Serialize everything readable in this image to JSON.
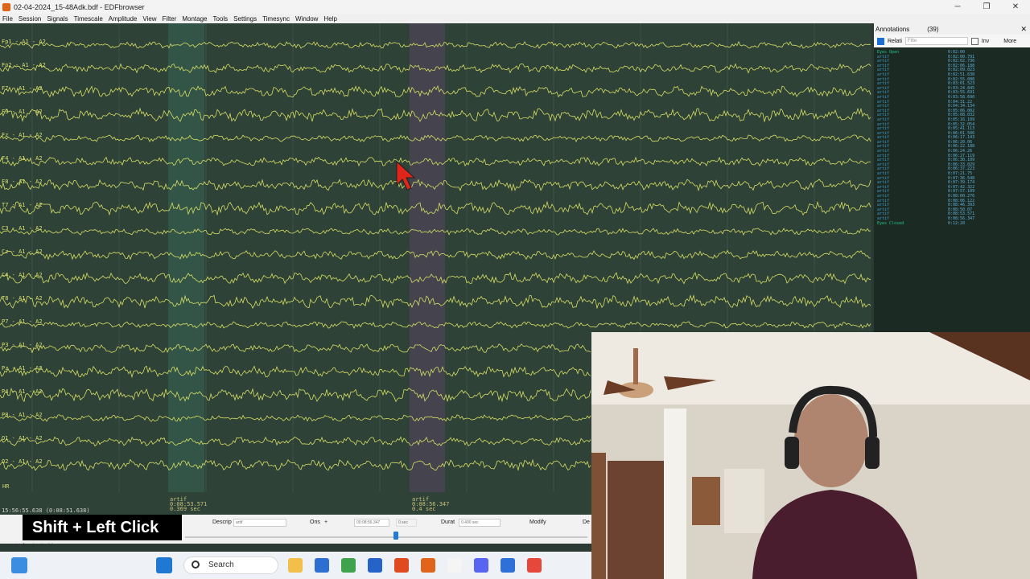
{
  "window": {
    "title": "02-04-2024_15-48Adk.bdf - EDFbrowser",
    "controls": [
      "─",
      "❐",
      "✕"
    ]
  },
  "menu": [
    "File",
    "Session",
    "Signals",
    "Timescale",
    "Amplitude",
    "View",
    "Filter",
    "Montage",
    "Tools",
    "Settings",
    "Timesync",
    "Window",
    "Help"
  ],
  "signals": {
    "channels": [
      "Fp1 - A1 - A2",
      "Fp2 - A1 - A2",
      "F7 - A1 - A2",
      "F3 - A1 - A2",
      "Fz - A1 - A2",
      "F4 - A1 - A2",
      "F8 - A1 - A2",
      "T7 - A1 - A2",
      "C3 - A1 - A2",
      "Cz - A1 - A2",
      "C4 - A1 - A2",
      "T8 - A1 - A2",
      "P7 - A1 - A2",
      "P3 - A1 - A2",
      "Pz - A1 - A2",
      "P4 - A1 - A2",
      "P8 - A1 - A2",
      "O1 - A1 - A2",
      "O2 - A1 - A2"
    ],
    "hr_label": "HR",
    "annotations_shown": [
      {
        "label": "artif",
        "onset": "0:08:53.571",
        "duration": "0.369 sec"
      },
      {
        "label": "artif",
        "onset": "0:08:56.347",
        "duration": "0.4 sec"
      }
    ],
    "time_readout": "15:56:55.638 (0:08:51.638)"
  },
  "editor": {
    "description_label": "Descrip",
    "description_value": "artif",
    "onset_label": "Ons",
    "onset_sign": "+",
    "onset_value": "00:08:56.347",
    "onset_extra": "0 sec",
    "duration_label": "Durat",
    "duration_value": "0.400 sec",
    "modify_label": "Modify",
    "delete_label": "De",
    "hint": "Shift + Left Click",
    "play_controls": "⏮ ■ ▶ ◇ ⋀ ⋁ ‹ › ⏭"
  },
  "annotations_panel": {
    "title": "Annotations",
    "count": "(39)",
    "relative_label": "Relati",
    "filter_placeholder": "Filte",
    "inv_label": "Inv",
    "more_label": "More",
    "items": [
      {
        "desc": "Eyes Open",
        "time": "0:02:00",
        "green": true
      },
      {
        "desc": "artif",
        "time": "0:02:00.791"
      },
      {
        "desc": "artif",
        "time": "0:02:02.736"
      },
      {
        "desc": "artif",
        "time": "0:02:06.188"
      },
      {
        "desc": "artif",
        "time": "0:02:09.023"
      },
      {
        "desc": "artif",
        "time": "0:02:51.638"
      },
      {
        "desc": "artif",
        "time": "0:02:55.088"
      },
      {
        "desc": "artif",
        "time": "0:03:01.523"
      },
      {
        "desc": "artif",
        "time": "0:03:24.845"
      },
      {
        "desc": "artif",
        "time": "0:03:55.691"
      },
      {
        "desc": "artif",
        "time": "0:03:58.690"
      },
      {
        "desc": "artif",
        "time": "0:04:31.22"
      },
      {
        "desc": "artif",
        "time": "0:04:34.134"
      },
      {
        "desc": "artif",
        "time": "0:05:06.002"
      },
      {
        "desc": "artif",
        "time": "0:05:08.032"
      },
      {
        "desc": "artif",
        "time": "0:05:16.109"
      },
      {
        "desc": "artif",
        "time": "0:05:32.054"
      },
      {
        "desc": "artif",
        "time": "0:05:41.113"
      },
      {
        "desc": "artif",
        "time": "0:06:01.506"
      },
      {
        "desc": "artif",
        "time": "0:06:17.143"
      },
      {
        "desc": "artif",
        "time": "0:06:20.06"
      },
      {
        "desc": "artif",
        "time": "0:06:22.188"
      },
      {
        "desc": "artif",
        "time": "0:06:24.26"
      },
      {
        "desc": "artif",
        "time": "0:06:27.119"
      },
      {
        "desc": "artif",
        "time": "0:06:30.109"
      },
      {
        "desc": "artif",
        "time": "0:06:33.029"
      },
      {
        "desc": "artif",
        "time": "0:06:37.223"
      },
      {
        "desc": "artif",
        "time": "0:07:21.75"
      },
      {
        "desc": "artif",
        "time": "0:07:36.548"
      },
      {
        "desc": "artif",
        "time": "0:07:39.174"
      },
      {
        "desc": "artif",
        "time": "0:07:42.322"
      },
      {
        "desc": "artif",
        "time": "0:07:57.109"
      },
      {
        "desc": "artif",
        "time": "0:08:00.276"
      },
      {
        "desc": "artif",
        "time": "0:08:06.122"
      },
      {
        "desc": "artif",
        "time": "0:08:46.393"
      },
      {
        "desc": "artif",
        "time": "0:08:50.07"
      },
      {
        "desc": "artif",
        "time": "0:08:53.571"
      },
      {
        "desc": "artif",
        "time": "0:08:56.347"
      },
      {
        "desc": "Eyes Closed",
        "time": "0:12:20",
        "green": true
      }
    ]
  },
  "taskbar": {
    "search_label": "Search",
    "icons": [
      "windows-start-icon",
      "files-icon",
      "store-icon",
      "sheets-icon",
      "keynote-icon",
      "office-icon",
      "edfbrowser-icon",
      "notes-icon",
      "discord-icon",
      "app-icon",
      "chrome-icon"
    ]
  }
}
